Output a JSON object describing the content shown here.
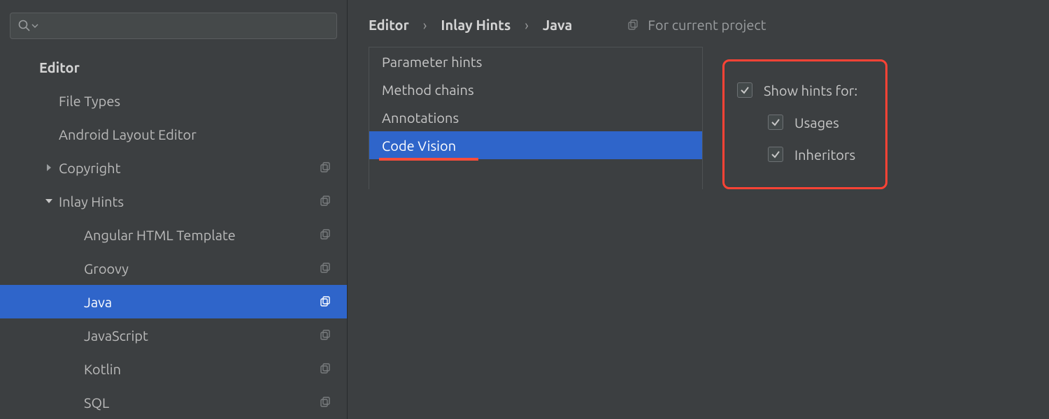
{
  "search": {
    "placeholder": ""
  },
  "sidebar": {
    "heading": "Editor",
    "items": [
      {
        "label": "File Types",
        "depth": 1,
        "expandable": false,
        "copy": false
      },
      {
        "label": "Android Layout Editor",
        "depth": 1,
        "expandable": false,
        "copy": false
      },
      {
        "label": "Copyright",
        "depth": 1,
        "expandable": true,
        "expanded": false,
        "copy": true
      },
      {
        "label": "Inlay Hints",
        "depth": 1,
        "expandable": true,
        "expanded": true,
        "copy": true
      },
      {
        "label": "Angular HTML Template",
        "depth": 2,
        "copy": true
      },
      {
        "label": "Groovy",
        "depth": 2,
        "copy": true
      },
      {
        "label": "Java",
        "depth": 2,
        "copy": true,
        "selected": true
      },
      {
        "label": "JavaScript",
        "depth": 2,
        "copy": true
      },
      {
        "label": "Kotlin",
        "depth": 2,
        "copy": true
      },
      {
        "label": "SQL",
        "depth": 2,
        "copy": true
      }
    ]
  },
  "breadcrumb": [
    "Editor",
    "Inlay Hints",
    "Java"
  ],
  "scope_note": "For current project",
  "hint_kinds": [
    {
      "label": "Parameter hints",
      "selected": false
    },
    {
      "label": "Method chains",
      "selected": false
    },
    {
      "label": "Annotations",
      "selected": false
    },
    {
      "label": "Code Vision",
      "selected": true
    }
  ],
  "options": {
    "title": "Show hints for:",
    "title_checked": true,
    "items": [
      {
        "label": "Usages",
        "checked": true
      },
      {
        "label": "Inheritors",
        "checked": true
      }
    ]
  }
}
